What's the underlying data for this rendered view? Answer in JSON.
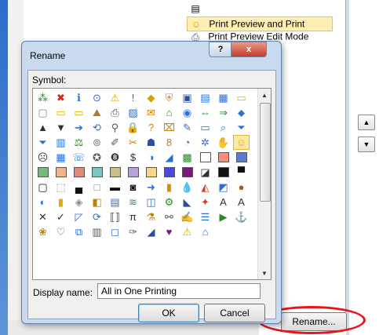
{
  "background_list": {
    "items": [
      {
        "label": "",
        "icon": "generic-command-icon",
        "selected": false
      },
      {
        "label": "Print Preview and Print",
        "icon": "smiley-icon",
        "selected": true
      },
      {
        "label": "Print Preview Edit Mode",
        "icon": "print-preview-icon",
        "selected": false
      }
    ]
  },
  "buttons": {
    "move_up": "▲",
    "move_down": "▼",
    "rename": "Rename..."
  },
  "dialog": {
    "title": "Rename",
    "help": "?",
    "close": "x",
    "symbol_label": "Symbol:",
    "display_name_label": "Display name:",
    "display_name_value": "All in One Printing",
    "ok": "OK",
    "cancel": "Cancel"
  },
  "symbols": [
    {
      "g": "⁂",
      "c": "#2a8a2a",
      "n": "org-chart-icon"
    },
    {
      "g": "✖",
      "c": "#d22",
      "n": "error-icon"
    },
    {
      "g": "ℹ",
      "c": "#2a6fd6",
      "n": "info-icon"
    },
    {
      "g": "⊙",
      "c": "#2a6fd6",
      "n": "target-icon"
    },
    {
      "g": "⚠",
      "c": "#e0a800",
      "n": "warning-icon"
    },
    {
      "g": "!",
      "c": "#d22",
      "n": "exclamation-icon"
    },
    {
      "g": "◆",
      "c": "#e09a00",
      "n": "diamond-icon"
    },
    {
      "g": "⛨",
      "c": "#e08a00",
      "n": "shield-icon"
    },
    {
      "g": "▣",
      "c": "#2a4fa0",
      "n": "save-icon"
    },
    {
      "g": "▤",
      "c": "#2a6fd6",
      "n": "copy-icon"
    },
    {
      "g": "▦",
      "c": "#2a6fd6",
      "n": "paste-icon"
    },
    {
      "g": "▭",
      "c": "#e0b000",
      "n": "folder-icon"
    },
    {
      "g": "▢",
      "c": "#888",
      "n": "blank-page-icon"
    },
    {
      "g": "▭",
      "c": "#e0b000",
      "n": "open-folder-icon"
    },
    {
      "g": "▭",
      "c": "#e0b000",
      "n": "folder-up-icon"
    },
    {
      "g": "⛰",
      "c": "#b07a30",
      "n": "picture-icon"
    },
    {
      "g": "⎙",
      "c": "#555",
      "n": "printer-icon"
    },
    {
      "g": "▨",
      "c": "#2a6fd6",
      "n": "chart-doc-icon"
    },
    {
      "g": "✉",
      "c": "#c08000",
      "n": "envelope-icon"
    },
    {
      "g": "⌂",
      "c": "#2a8a2a",
      "n": "home-icon"
    },
    {
      "g": "◉",
      "c": "#2a6fd6",
      "n": "globe-icon"
    },
    {
      "g": "⇔",
      "c": "#2a8a2a",
      "n": "exchange-icon"
    },
    {
      "g": "⇒",
      "c": "#2a8a2a",
      "n": "forward-icon"
    },
    {
      "g": "⬥",
      "c": "#2a6fd6",
      "n": "small-diamond-icon"
    },
    {
      "g": "▲",
      "c": "#333",
      "n": "triangle-up-icon"
    },
    {
      "g": "▼",
      "c": "#333",
      "n": "triangle-down-icon"
    },
    {
      "g": "➔",
      "c": "#2a6fd6",
      "n": "arrow-right-icon"
    },
    {
      "g": "⟲",
      "c": "#2a6fd6",
      "n": "refresh-icon"
    },
    {
      "g": "⚲",
      "c": "#555",
      "n": "pin-icon"
    },
    {
      "g": "🔒",
      "c": "#c08000",
      "n": "lock-icon"
    },
    {
      "g": "?",
      "c": "#c08000",
      "n": "question-icon"
    },
    {
      "g": "⌧",
      "c": "#c08000",
      "n": "erase-icon"
    },
    {
      "g": "✎",
      "c": "#2a6fd6",
      "n": "pencil-icon"
    },
    {
      "g": "▭",
      "c": "#2a6fd6",
      "n": "window-icon"
    },
    {
      "g": "⌕",
      "c": "#2a6fd6",
      "n": "magnifier-icon"
    },
    {
      "g": "⏷",
      "c": "#2a6fd6",
      "n": "filter-icon"
    },
    {
      "g": "⏷",
      "c": "#2a6fd6",
      "n": "filter2-icon"
    },
    {
      "g": "▥",
      "c": "#2a6fd6",
      "n": "book-icon"
    },
    {
      "g": "⚖",
      "c": "#2a8a2a",
      "n": "scales-icon"
    },
    {
      "g": "⊚",
      "c": "#777",
      "n": "link-icon"
    },
    {
      "g": "✐",
      "c": "#555",
      "n": "stylus-icon"
    },
    {
      "g": "✂",
      "c": "#c08000",
      "n": "scissors-icon"
    },
    {
      "g": "☗",
      "c": "#2a4fa0",
      "n": "people-icon"
    },
    {
      "g": "8",
      "c": "#c08000",
      "n": "eight-icon"
    },
    {
      "g": "◔",
      "c": "#2a6fd6",
      "n": "clock-icon"
    },
    {
      "g": "✲",
      "c": "#2a6fd6",
      "n": "asterisk-icon"
    },
    {
      "g": "✋",
      "c": "#e0a800",
      "n": "hand-icon"
    },
    {
      "g": "☺",
      "c": "#e0a800",
      "n": "smiley-icon"
    },
    {
      "g": "☹",
      "c": "#333",
      "n": "frown-icon"
    },
    {
      "g": "▦",
      "c": "#2a6fd6",
      "n": "grid-icon"
    },
    {
      "g": "☏",
      "c": "#2a6fd6",
      "n": "phone-icon"
    },
    {
      "g": "✪",
      "c": "#555",
      "n": "badge-icon"
    },
    {
      "g": "❽",
      "c": "#333",
      "n": "ball-icon"
    },
    {
      "g": "$",
      "c": "#333",
      "n": "dollar-icon"
    },
    {
      "g": "◑",
      "c": "#2a6fd6",
      "n": "eye-icon"
    },
    {
      "g": "◢",
      "c": "#2a6fd6",
      "n": "wedge-icon"
    },
    {
      "g": "▩",
      "c": "#2a8a2a",
      "n": "colorful-grid-icon"
    },
    {
      "g": "",
      "c": "#ffffff",
      "n": "swatch-white-icon",
      "sq": true
    },
    {
      "g": "",
      "c": "#ff8a7a",
      "n": "swatch-salmon-icon",
      "sq": true
    },
    {
      "g": "",
      "c": "#5a7ad6",
      "n": "swatch-blue-icon",
      "sq": true
    },
    {
      "g": "",
      "c": "#78b878",
      "n": "swatch-green-icon",
      "sq": true
    },
    {
      "g": "",
      "c": "#f4b38a",
      "n": "swatch-peach-icon",
      "sq": true
    },
    {
      "g": "",
      "c": "#e08a7a",
      "n": "swatch-rose-icon",
      "sq": true
    },
    {
      "g": "",
      "c": "#78c8c0",
      "n": "swatch-teal-icon",
      "sq": true
    },
    {
      "g": "",
      "c": "#c8c088",
      "n": "swatch-khaki-icon",
      "sq": true
    },
    {
      "g": "",
      "c": "#b8a0d8",
      "n": "swatch-lavender-icon",
      "sq": true
    },
    {
      "g": "",
      "c": "#f8d888",
      "n": "swatch-yellow-icon",
      "sq": true
    },
    {
      "g": "",
      "c": "#4a4ad6",
      "n": "swatch-indigo-icon",
      "sq": true
    },
    {
      "g": "",
      "c": "#7a1a7a",
      "n": "swatch-purple-icon",
      "sq": true
    },
    {
      "g": "◪",
      "c": "#333",
      "n": "contrast-icon"
    },
    {
      "g": "",
      "c": "#111111",
      "n": "swatch-black-icon",
      "sq": true
    },
    {
      "g": "▀",
      "c": "#111",
      "n": "half-black-icon"
    },
    {
      "g": "▢",
      "c": "#111",
      "n": "white-box-icon"
    },
    {
      "g": "⬚",
      "c": "#888",
      "n": "dotted-box-icon"
    },
    {
      "g": "▄",
      "c": "#111",
      "n": "bottom-black-icon"
    },
    {
      "g": "□",
      "c": "#888",
      "n": "empty-box-icon"
    },
    {
      "g": "▬",
      "c": "#111",
      "n": "bar-icon"
    },
    {
      "g": "◙",
      "c": "#111",
      "n": "inverse-circle-icon"
    },
    {
      "g": "➜",
      "c": "#2a6fd6",
      "n": "arrow-circle-icon"
    },
    {
      "g": "▮",
      "c": "#e08a00",
      "n": "bar-chart-icon"
    },
    {
      "g": "💧",
      "c": "#2a6fd6",
      "n": "drop-icon"
    },
    {
      "g": "◭",
      "c": "#d0401a",
      "n": "mountain-icon"
    },
    {
      "g": "◩",
      "c": "#2a6fd6",
      "n": "split-box-icon"
    },
    {
      "g": "●",
      "c": "#c84a1a",
      "n": "pie-icon"
    },
    {
      "g": "◐",
      "c": "#2a6fd6",
      "n": "half-circle-icon"
    },
    {
      "g": "▮",
      "c": "#e0a800",
      "n": "column-icon"
    },
    {
      "g": "◈",
      "c": "#888",
      "n": "cube-icon"
    },
    {
      "g": "◧",
      "c": "#c08000",
      "n": "notebook-icon"
    },
    {
      "g": "▤",
      "c": "#2a6fd6",
      "n": "list-doc-icon"
    },
    {
      "g": "≋",
      "c": "#2a8a8a",
      "n": "waves-icon"
    },
    {
      "g": "◫",
      "c": "#2a6fd6",
      "n": "panel-icon"
    },
    {
      "g": "⚙",
      "c": "#2a8a2a",
      "n": "gear-icon"
    },
    {
      "g": "◣",
      "c": "#2a4fa0",
      "n": "corner-icon"
    },
    {
      "g": "✦",
      "c": "#d0401a",
      "n": "star-icon"
    },
    {
      "g": "A",
      "c": "#333",
      "n": "text-a-icon"
    },
    {
      "g": "A",
      "c": "#333",
      "n": "text-a2-icon"
    },
    {
      "g": "✕",
      "c": "#333",
      "n": "x-icon"
    },
    {
      "g": "✓",
      "c": "#333",
      "n": "check-icon"
    },
    {
      "g": "◸",
      "c": "#2a6fd6",
      "n": "ruler-icon"
    },
    {
      "g": "⟳",
      "c": "#2a6fd6",
      "n": "rotate-icon"
    },
    {
      "g": "⟦⟧",
      "c": "#333",
      "n": "brackets-icon"
    },
    {
      "g": "π",
      "c": "#333",
      "n": "pi-icon"
    },
    {
      "g": "⚗",
      "c": "#c08000",
      "n": "flask-icon"
    },
    {
      "g": "⚯",
      "c": "#555",
      "n": "binoculars-icon"
    },
    {
      "g": "✍",
      "c": "#555",
      "n": "writing-icon"
    },
    {
      "g": "☰",
      "c": "#2a6fd6",
      "n": "list-icon"
    },
    {
      "g": "▶",
      "c": "#2a8a2a",
      "n": "play-icon"
    },
    {
      "g": "⚓",
      "c": "#2a6fd6",
      "n": "anchor-icon"
    },
    {
      "g": "❀",
      "c": "#c08000",
      "n": "flower-icon"
    },
    {
      "g": "♡",
      "c": "#7a1a7a",
      "n": "heart-icon"
    },
    {
      "g": "⧉",
      "c": "#2a6fd6",
      "n": "windows-icon"
    },
    {
      "g": "▥",
      "c": "#555",
      "n": "doc-icon"
    },
    {
      "g": "◻",
      "c": "#2a6fd6",
      "n": "frame-icon"
    },
    {
      "g": "✑",
      "c": "#555",
      "n": "pen-icon"
    },
    {
      "g": "◢",
      "c": "#2a4fa0",
      "n": "draw-icon"
    },
    {
      "g": "♥",
      "c": "#7a1a7a",
      "n": "heart-filled-icon"
    },
    {
      "g": "⚠",
      "c": "#e0a800",
      "n": "bell-icon"
    },
    {
      "g": "⌂",
      "c": "#2a6fd6",
      "n": "house-icon"
    }
  ]
}
